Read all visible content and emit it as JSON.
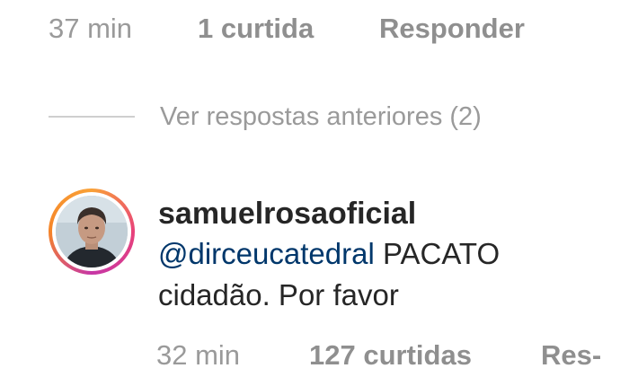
{
  "previous_comment": {
    "time": "37 min",
    "likes": "1 curtida",
    "reply": "Responder"
  },
  "view_replies": {
    "label": "Ver respostas anteriores (2)"
  },
  "reply_comment": {
    "username": "samuelrosaoficial",
    "mention": "@dirceucatedral",
    "text_line1": "PACATO",
    "text_line2": "cidadão. Por favor",
    "time": "32 min",
    "likes": "127 curtidas",
    "reply": "Res-"
  },
  "colors": {
    "text_primary": "#262626",
    "text_secondary": "#9a9a9a",
    "mention": "#00376b",
    "story_ring_start": "#f9a137",
    "story_ring_end": "#c636a6"
  },
  "icons": {
    "avatar": "user-avatar-photo"
  }
}
